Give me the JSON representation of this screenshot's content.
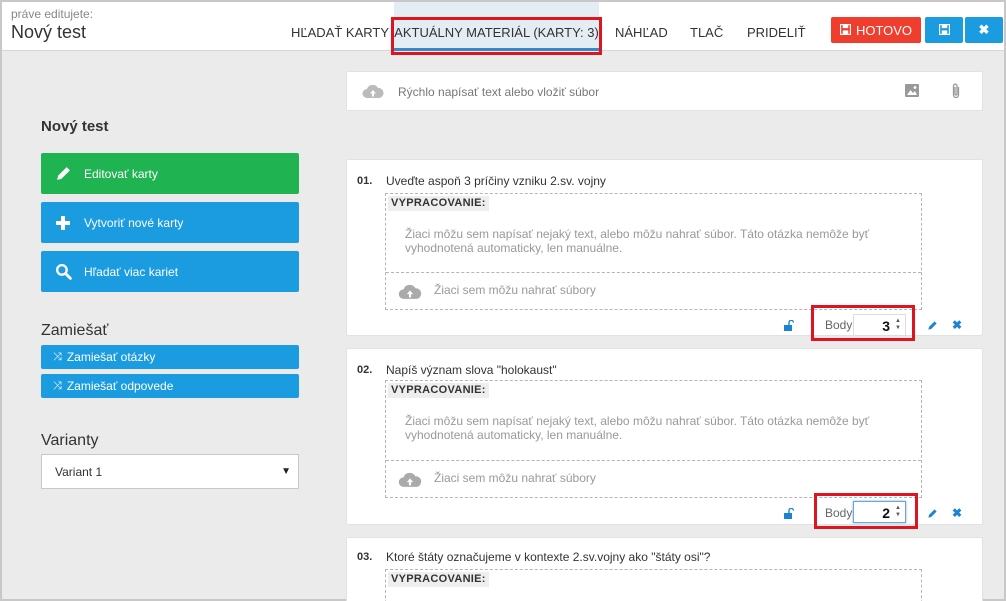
{
  "header": {
    "editing_label": "práve editujete:",
    "title": "Nový test",
    "tabs": [
      {
        "label": "HĽADAŤ KARTY"
      },
      {
        "label": "AKTUÁLNY MATERIÁL (KARTY: 3)"
      },
      {
        "label": "NÁHĽAD"
      },
      {
        "label": "TLAČ"
      },
      {
        "label": "PRIDELIŤ"
      }
    ],
    "done_label": "HOTOVO"
  },
  "sidebar": {
    "title": "Nový test",
    "buttons": [
      {
        "label": "Editovať karty"
      },
      {
        "label": "Vytvoriť nové karty"
      },
      {
        "label": "Hľadať viac kariet"
      }
    ],
    "shuffle_heading": "Zamiešať",
    "shuffle_questions": "Zamiešať otázky",
    "shuffle_answers": "Zamiešať odpovede",
    "variants_heading": "Varianty",
    "variant_selected": "Variant 1"
  },
  "quickbar": {
    "placeholder": "Rýchlo napísať text alebo vložiť súbor"
  },
  "cards": [
    {
      "number": "01.",
      "question": "Uveďte aspoň 3 príčiny vzniku 2.sv. vojny",
      "answer_label": "VYPRACOVANIE:",
      "hint": "Žiaci môžu sem napísať nejaký text, alebo môžu nahrať súbor. Táto otázka nemôže byť vyhodnotená automaticky, len manuálne.",
      "upload_text": "Žiaci sem môžu nahrať súbory",
      "points_label": "Body:",
      "points": "3"
    },
    {
      "number": "02.",
      "question": "Napíš význam slova \"holokaust\"",
      "answer_label": "VYPRACOVANIE:",
      "hint": "Žiaci môžu sem napísať nejaký text, alebo môžu nahrať súbor. Táto otázka nemôže byť vyhodnotená automaticky, len manuálne.",
      "upload_text": "Žiaci sem môžu nahrať súbory",
      "points_label": "Body:",
      "points": "2"
    },
    {
      "number": "03.",
      "question": "Ktoré štáty označujeme v kontexte 2.sv.vojny ako \"štáty osi\"?",
      "answer_label": "VYPRACOVANIE:"
    }
  ],
  "colors": {
    "accent_blue": "#1b9be0",
    "green": "#1fb352",
    "done_red": "#f03e2e",
    "highlight_red": "#e0141e"
  }
}
